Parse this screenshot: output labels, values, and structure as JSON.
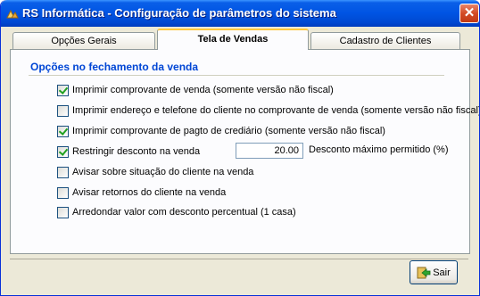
{
  "window": {
    "title": "RS Informática - Configuração de parâmetros do sistema",
    "close_label": "✕"
  },
  "tabs": [
    {
      "label": "Opções Gerais",
      "active": false
    },
    {
      "label": "Tela de Vendas",
      "active": true
    },
    {
      "label": "Cadastro de Clientes",
      "active": false
    }
  ],
  "group": {
    "title": "Opções no fechamento da venda"
  },
  "options": [
    {
      "label": "Imprimir comprovante de venda (somente versão não fiscal)",
      "checked": true
    },
    {
      "label": "Imprimir endereço e telefone do cliente no comprovante de venda (somente versão não fiscal)",
      "checked": false
    },
    {
      "label": "Imprimir comprovante de pagto de crediário (somente versão não fiscal)",
      "checked": true
    },
    {
      "label": "Restringir desconto na venda",
      "checked": true
    },
    {
      "label": "Avisar sobre situação do cliente na venda",
      "checked": false
    },
    {
      "label": "Avisar retornos do cliente na venda",
      "checked": false
    },
    {
      "label": "Arredondar valor com desconto percentual (1 casa)",
      "checked": false
    }
  ],
  "discount": {
    "value": "20.00",
    "label": "Desconto máximo permitido (%)"
  },
  "buttons": {
    "exit_label": "Sair"
  },
  "colors": {
    "title_bar": "#0054e3",
    "group_title": "#0046d5",
    "tab_highlight": "#ffc83c",
    "check": "#21a121"
  }
}
